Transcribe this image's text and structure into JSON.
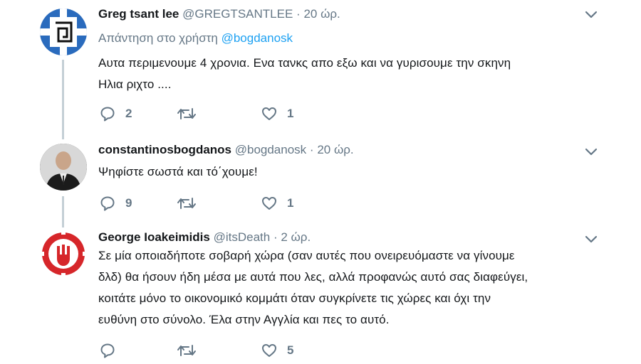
{
  "tweets": [
    {
      "name": "Greg tsant lee",
      "handle": "@GREGTSANTLEE",
      "separator": "·",
      "time": "20 ώρ.",
      "reply_prefix": "Απάντηση στο χρήστη",
      "reply_mention": "@bogdanosk",
      "text": "Αυτα περιμενουμε 4 χρονια. Ενα τανκς απο εξω και να γυρισουμε την σκηνη\nΗλια ριχτο ....",
      "replies": "2",
      "retweets": "",
      "likes": "1"
    },
    {
      "name": "constantinosbogdanos",
      "handle": "@bogdanosk",
      "separator": "·",
      "time": "20 ώρ.",
      "text": "Ψηφίστε σωστά και τό΄χουμε!",
      "replies": "9",
      "retweets": "",
      "likes": "1"
    },
    {
      "name": "George Ioakeimidis",
      "handle": "@itsDeath",
      "separator": "·",
      "time": "2 ώρ.",
      "text": "Σε μία οποιαδήποτε σοβαρή χώρα (σαν αυτές που ονειρευόμαστε να γίνουμε\nδλδ) θα ήσουν ήδη μέσα με αυτά που λες, αλλά προφανώς αυτό σας διαφεύγει,\nκοιτάτε μόνο το οικονομικό κομμάτι όταν συγκρίνετε τις χώρες και όχι την\nευθύνη στο σύνολο. Έλα στην Αγγλία και πες το αυτό.",
      "replies": "",
      "retweets": "",
      "likes": "5"
    }
  ],
  "icons": {
    "reply": "reply-bubble-icon",
    "retweet": "retweet-arrows-icon",
    "like": "heart-icon",
    "caret": "chevron-down-icon"
  },
  "colors": {
    "name": "#14171a",
    "secondary": "#657786",
    "mention": "#1da1f2",
    "thread_line": "#c4cfd6"
  }
}
